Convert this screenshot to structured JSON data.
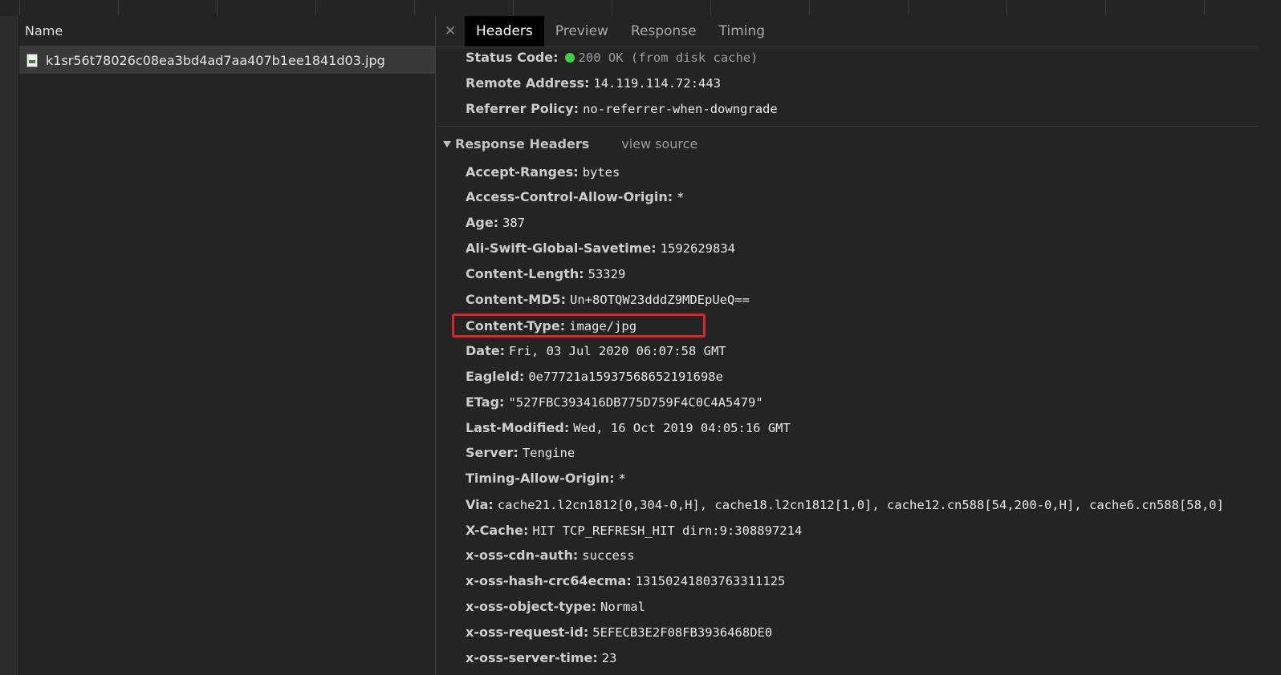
{
  "name_column": {
    "header": "Name",
    "files": [
      {
        "name": "k1sr56t78026c08ea3bd4ad7aa407b1ee1841d03.jpg",
        "icon": "image-file-icon"
      }
    ]
  },
  "tabs": {
    "close_icon": "close-icon",
    "items": [
      {
        "label": "Headers",
        "active": true
      },
      {
        "label": "Preview",
        "active": false
      },
      {
        "label": "Response",
        "active": false
      },
      {
        "label": "Timing",
        "active": false
      }
    ]
  },
  "general": [
    {
      "key": "Status Code:",
      "value": "200 OK (from disk cache)",
      "status_color": "#3bd43b"
    },
    {
      "key": "Remote Address:",
      "value": "14.119.114.72:443"
    },
    {
      "key": "Referrer Policy:",
      "value": "no-referrer-when-downgrade"
    }
  ],
  "response_headers": {
    "title": "Response Headers",
    "view_source": "view source",
    "items": [
      {
        "key": "Accept-Ranges:",
        "value": "bytes"
      },
      {
        "key": "Access-Control-Allow-Origin:",
        "value": "*"
      },
      {
        "key": "Age:",
        "value": "387"
      },
      {
        "key": "Ali-Swift-Global-Savetime:",
        "value": "1592629834"
      },
      {
        "key": "Content-Length:",
        "value": "53329"
      },
      {
        "key": "Content-MD5:",
        "value": "Un+8OTQW23dddZ9MDEpUeQ=="
      },
      {
        "key": "Content-Type:",
        "value": "image/jpg",
        "highlighted": true
      },
      {
        "key": "Date:",
        "value": "Fri, 03 Jul 2020 06:07:58 GMT"
      },
      {
        "key": "EagleId:",
        "value": "0e77721a15937568652191698e"
      },
      {
        "key": "ETag:",
        "value": "\"527FBC393416DB775D759F4C0C4A5479\""
      },
      {
        "key": "Last-Modified:",
        "value": "Wed, 16 Oct 2019 04:05:16 GMT"
      },
      {
        "key": "Server:",
        "value": "Tengine"
      },
      {
        "key": "Timing-Allow-Origin:",
        "value": "*"
      },
      {
        "key": "Via:",
        "value": "cache21.l2cn1812[0,304-0,H], cache18.l2cn1812[1,0], cache12.cn588[54,200-0,H], cache6.cn588[58,0]"
      },
      {
        "key": "X-Cache:",
        "value": "HIT TCP_REFRESH_HIT dirn:9:308897214"
      },
      {
        "key": "x-oss-cdn-auth:",
        "value": "success"
      },
      {
        "key": "x-oss-hash-crc64ecma:",
        "value": "13150241803763311125"
      },
      {
        "key": "x-oss-object-type:",
        "value": "Normal"
      },
      {
        "key": "x-oss-request-id:",
        "value": "5EFECB3E2F08FB3936468DE0"
      },
      {
        "key": "x-oss-server-time:",
        "value": "23"
      }
    ]
  },
  "highlight_color": "#e52222"
}
